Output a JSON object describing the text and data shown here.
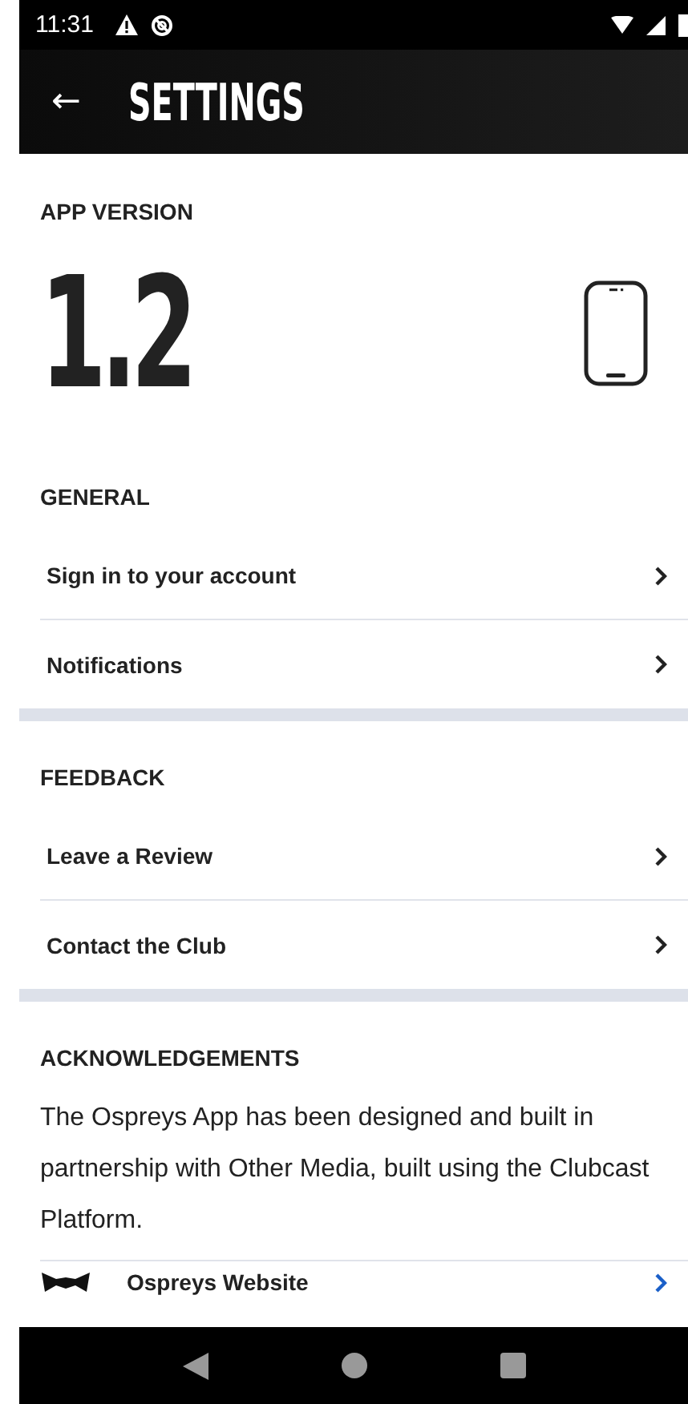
{
  "status_bar": {
    "time": "11:31"
  },
  "app_bar": {
    "back": "←",
    "title": "SETTINGS"
  },
  "app_version": {
    "heading": "APP VERSION",
    "version": "1.2"
  },
  "sections": [
    {
      "heading": "GENERAL",
      "items": [
        {
          "label": "Sign in to your account"
        },
        {
          "label": "Notifications"
        }
      ]
    },
    {
      "heading": "FEEDBACK",
      "items": [
        {
          "label": "Leave a Review"
        },
        {
          "label": "Contact the Club"
        }
      ]
    }
  ],
  "acknowledgements": {
    "heading": "ACKNOWLEDGEMENTS",
    "text": "The Ospreys App has been designed and built in partnership with Other Media, built using the Clubcast Platform.",
    "link": {
      "label": "Ospreys Website"
    }
  }
}
